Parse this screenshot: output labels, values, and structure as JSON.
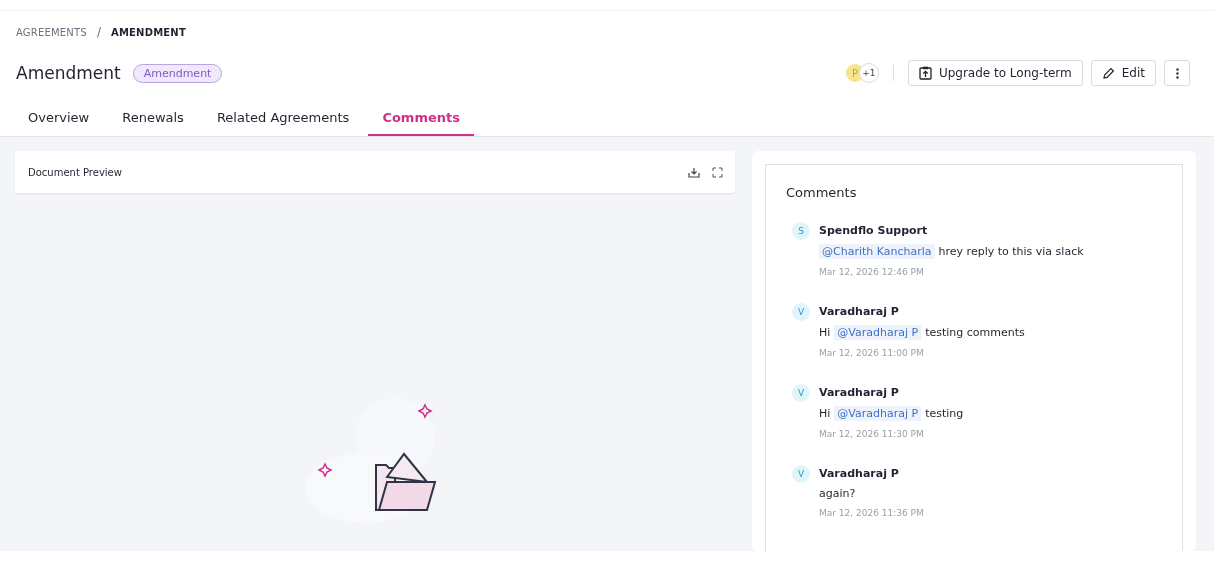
{
  "breadcrumb": [
    {
      "label": "AGREEMENTS",
      "current": false
    },
    {
      "label": "AMENDMENT",
      "current": true
    }
  ],
  "breadcrumb_separator": "/",
  "title": "Amendment",
  "type_badge": "Amendment",
  "collaborators": {
    "initial": "P",
    "more": "+1"
  },
  "actions": [
    {
      "kind": "upgrade",
      "label": "Upgrade to Long-term"
    },
    {
      "kind": "edit",
      "label": "Edit"
    },
    {
      "kind": "more"
    }
  ],
  "tabs": [
    {
      "label": "Overview",
      "selected": false
    },
    {
      "label": "Renewals",
      "selected": false
    },
    {
      "label": "Related Agreements",
      "selected": false
    },
    {
      "label": "Comments",
      "selected": true
    }
  ],
  "document_preview": {
    "title": "Document Preview"
  },
  "comments": {
    "title": "Comments",
    "items": [
      {
        "initial": "S",
        "author": "Spendflo Support",
        "body": [
          {
            "kind": "mention",
            "text": "@Charith Kancharla"
          },
          {
            "kind": "text",
            "text": "hrey reply to this via slack"
          }
        ],
        "time": "Mar 12, 2026 12:46 PM"
      },
      {
        "initial": "V",
        "author": "Varadharaj P",
        "body": [
          {
            "kind": "text",
            "text": "Hi"
          },
          {
            "kind": "mention",
            "text": "@Varadharaj P"
          },
          {
            "kind": "text",
            "text": "testing comments"
          }
        ],
        "time": "Mar 12, 2026 11:00 PM"
      },
      {
        "initial": "V",
        "author": "Varadharaj P",
        "body": [
          {
            "kind": "text",
            "text": "Hi"
          },
          {
            "kind": "mention",
            "text": "@Varadharaj P"
          },
          {
            "kind": "text",
            "text": "testing"
          }
        ],
        "time": "Mar 12, 2026 11:30 PM"
      },
      {
        "initial": "V",
        "author": "Varadharaj P",
        "body": [
          {
            "kind": "text",
            "text": "again?"
          }
        ],
        "time": "Mar 12, 2026 11:36 PM"
      }
    ]
  }
}
